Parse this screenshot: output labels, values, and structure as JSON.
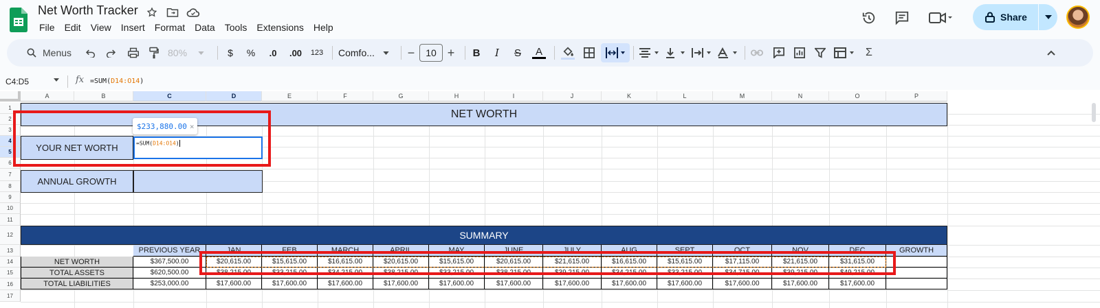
{
  "app": {
    "title": "Net Worth Tracker",
    "menus": [
      "File",
      "Edit",
      "View",
      "Insert",
      "Format",
      "Data",
      "Tools",
      "Extensions",
      "Help"
    ],
    "share_label": "Share"
  },
  "toolbar": {
    "search_label": "Menus",
    "zoom": "80%",
    "currency": "$",
    "percent": "%",
    "dec_decrease": ".0",
    "dec_increase": ".00",
    "number_format": "123",
    "font": "Comfo...",
    "font_size": "10",
    "minus": "−",
    "plus": "+",
    "bold": "B",
    "italic": "I",
    "strike": "S",
    "text_color": "A",
    "sum_symbol": "Σ"
  },
  "formula_bar": {
    "name_box": "C4:D5",
    "fx": "fx",
    "formula_prefix": "=SUM(",
    "formula_range": "D14:O14",
    "formula_suffix": ")"
  },
  "grid": {
    "columns": [
      "A",
      "B",
      "C",
      "D",
      "E",
      "F",
      "G",
      "H",
      "I",
      "J",
      "K",
      "L",
      "M",
      "N",
      "O",
      "P"
    ],
    "rows": [
      "1",
      "2",
      "3",
      "4",
      "5",
      "6",
      "7",
      "8",
      "9",
      "10",
      "11",
      "12",
      "13",
      "14",
      "15",
      "16",
      "17"
    ]
  },
  "sheet": {
    "net_worth_title": "NET WORTH",
    "your_net_worth_label": "YOUR NET WORTH",
    "annual_growth_label": "ANNUAL GROWTH",
    "formula_preview": "$233,880.00",
    "edit_prefix": "=SUM(",
    "edit_range": "D14:O14",
    "edit_suffix": ")",
    "summary_title": "SUMMARY",
    "table_headers": [
      "PREVIOUS YEAR",
      "JAN",
      "FEB",
      "MARCH",
      "APRIL",
      "MAY",
      "JUNE",
      "JULY",
      "AUG",
      "SEPT",
      "OCT",
      "NOV",
      "DEC",
      "GROWTH"
    ],
    "table_rows": [
      {
        "label": "NET WORTH",
        "values": [
          "$367,500.00",
          "$20,615.00",
          "$15,615.00",
          "$16,615.00",
          "$20,615.00",
          "$15,615.00",
          "$20,615.00",
          "$21,615.00",
          "$16,615.00",
          "$15,615.00",
          "$17,115.00",
          "$21,615.00",
          "$31,615.00",
          ""
        ]
      },
      {
        "label": "TOTAL ASSETS",
        "values": [
          "$620,500.00",
          "$38,215.00",
          "$33,215.00",
          "$34,215.00",
          "$38,215.00",
          "$33,215.00",
          "$38,215.00",
          "$39,215.00",
          "$34,215.00",
          "$33,215.00",
          "$34,715.00",
          "$39,215.00",
          "$49,215.00",
          ""
        ]
      },
      {
        "label": "TOTAL LIABILITIES",
        "values": [
          "$253,000.00",
          "$17,600.00",
          "$17,600.00",
          "$17,600.00",
          "$17,600.00",
          "$17,600.00",
          "$17,600.00",
          "$17,600.00",
          "$17,600.00",
          "$17,600.00",
          "$17,600.00",
          "$17,600.00",
          "$17,600.00",
          ""
        ]
      }
    ]
  },
  "colors": {
    "band_blue": "#c9daf8",
    "summary_navy": "#1c4587",
    "highlight_red": "#e8191a",
    "range_orange": "#e37400",
    "selection_blue": "#1a73e8"
  }
}
